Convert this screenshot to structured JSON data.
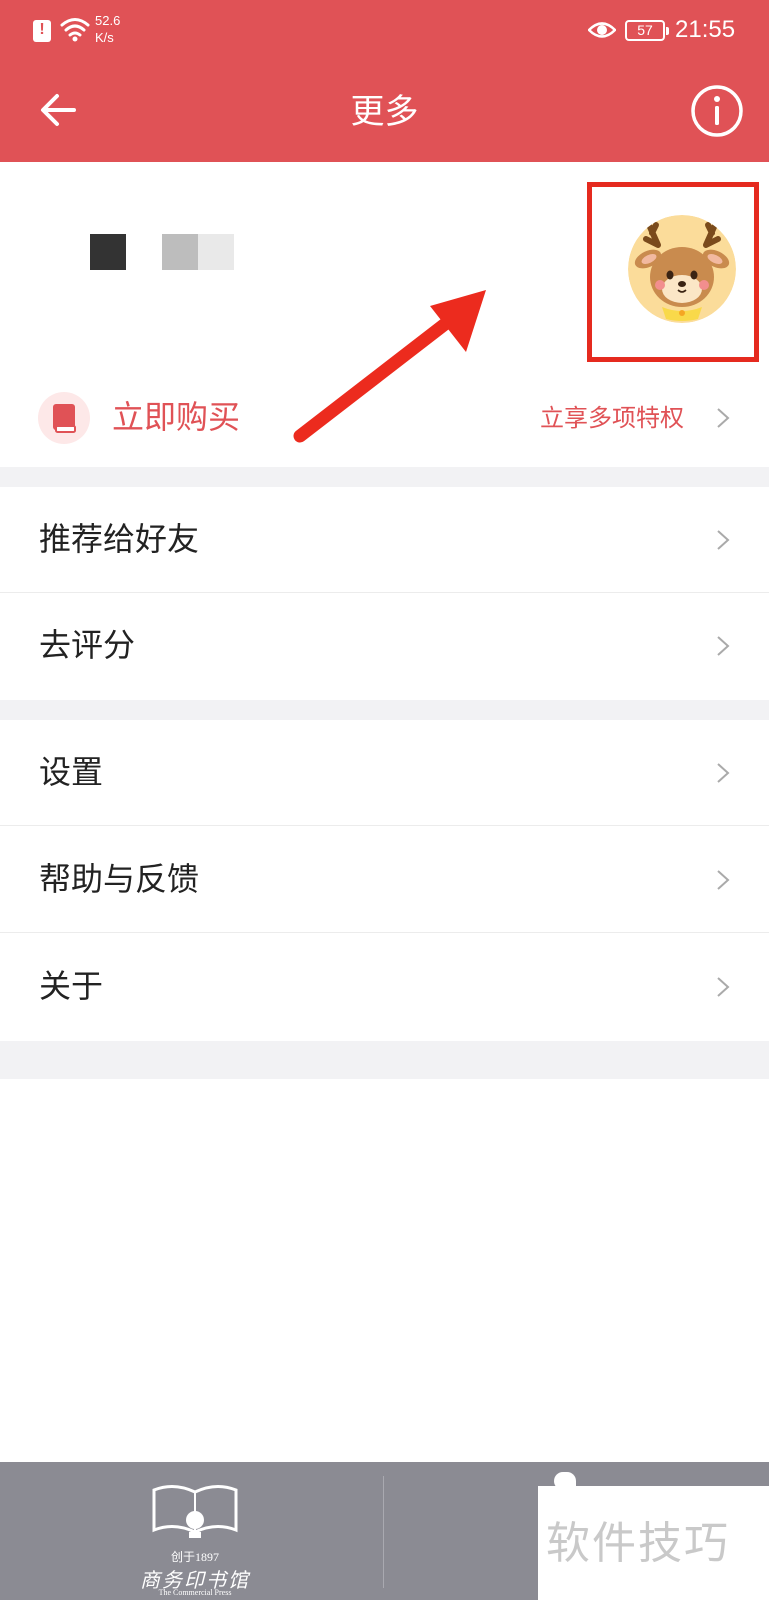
{
  "status_bar": {
    "net_speed_value": "52.6",
    "net_speed_unit": "K/s",
    "battery": "57",
    "time": "21:55"
  },
  "app_bar": {
    "title": "更多",
    "back_icon": "arrow-left-icon",
    "info_icon": "info-icon"
  },
  "profile": {
    "avatar_icon": "deer-avatar",
    "highlight_color": "#e52a1f"
  },
  "buy": {
    "label": "立即购买",
    "hint": "立享多项特权",
    "icon": "book-icon"
  },
  "menu_groups": [
    [
      {
        "label": "推荐给好友"
      },
      {
        "label": "去评分"
      }
    ],
    [
      {
        "label": "设置"
      },
      {
        "label": "帮助与反馈"
      },
      {
        "label": "关于"
      }
    ]
  ],
  "footer": {
    "logo_established": "创于1897",
    "logo_name": "商务印书馆",
    "logo_subtitle": "The Commercial Press"
  },
  "watermark": {
    "text": "软件技巧"
  },
  "colors": {
    "accent": "#e05256",
    "footer_bg": "#8b8b93",
    "section_gap": "#f2f2f4"
  }
}
